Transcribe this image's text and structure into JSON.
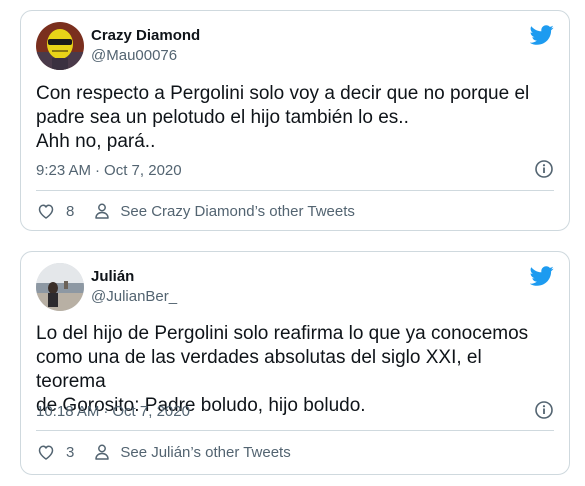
{
  "tweets": [
    {
      "display_name": "Crazy Diamond",
      "handle": "@Mau00076",
      "text": "Con respecto a Pergolini solo voy a decir que no porque el\npadre sea un pelotudo el hijo también lo es..\nAhh no, pará..",
      "time": "9:23 AM",
      "date": "Oct 7, 2020",
      "likes": "8",
      "profile_link": "See Crazy Diamond’s other Tweets",
      "avatar_icon": "avatar-yellow-face-sunglasses"
    },
    {
      "display_name": "Julián",
      "handle": "@JulianBer_",
      "text": "Lo del hijo de Pergolini solo reafirma lo que ya conocemos\ncomo una de las verdades absolutas del siglo XXI, el teorema\nde Gorosito: Padre boludo, hijo boludo.",
      "time": "10:18 AM",
      "date": "Oct 7, 2020",
      "likes": "3",
      "profile_link": "See Julián’s other Tweets",
      "avatar_icon": "avatar-seaside-photo"
    }
  ],
  "separator": "·",
  "colors": {
    "twitter_blue": "#1d9bf0",
    "text": "#0f1419",
    "secondary": "#536471",
    "border": "#cfd9de"
  },
  "icons": {
    "brand": "twitter-bird-icon",
    "info": "info-icon",
    "like": "heart-icon",
    "profile": "person-icon"
  }
}
